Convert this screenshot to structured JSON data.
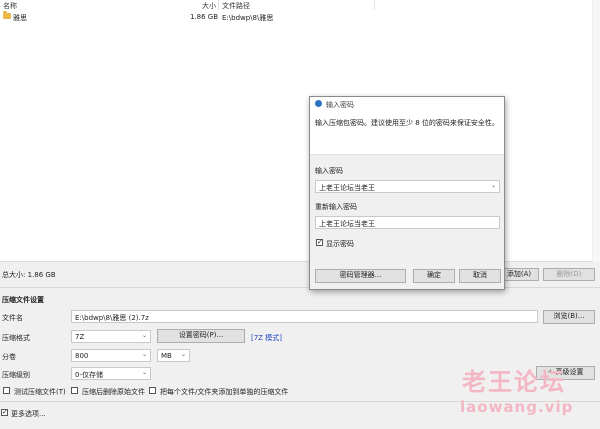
{
  "file_list": {
    "columns": {
      "name": "名称",
      "size": "大小",
      "path": "文件路径"
    },
    "rows": [
      {
        "name": "雅思",
        "size": "1.86 GB",
        "path": "E:\\bdwp\\8\\雅思",
        "icon": "folder-icon"
      }
    ]
  },
  "status": {
    "total_size": "总大小: 1.86 GB"
  },
  "toolbar": {
    "add_label": "添加(A)",
    "delete_label": "删除(D)"
  },
  "settings": {
    "section_title": "压缩文件设置",
    "filename_label": "文件名",
    "filename_value": "E:\\bdwp\\8\\雅思 (2).7z",
    "browse_label": "浏览(B)...",
    "format_label": "压缩格式",
    "format_value": "7Z",
    "set_password_label": "设置密码(P)...",
    "format_mode": "[7Z 模式]",
    "volume_label": "分卷",
    "volume_value": "800",
    "volume_unit": "MB",
    "level_label": "压缩级别",
    "level_value": "0-仅存储",
    "advanced_label": "+ 高级设置",
    "opt_test": "测试压缩文件(T)",
    "opt_delete": "压缩后删除原始文件",
    "opt_separate": "把每个文件/文件夹添加到单独的压缩文件",
    "more_options": "更多选项..."
  },
  "dialog": {
    "title": "输入密码",
    "info": "输入压缩包密码。建议使用至少 8 位的密码来保证安全性。",
    "password_label": "输入密码",
    "password_value": "上老王论坛当老王",
    "reenter_label": "重新输入密码",
    "reenter_value": "上老王论坛当老王",
    "show_password": "显示密码",
    "show_password_checked": true,
    "manager_label": "密码管理器...",
    "ok_label": "确定",
    "cancel_label": "取消"
  },
  "watermark": {
    "cn": "老王论坛",
    "en": "laowang.vip"
  }
}
